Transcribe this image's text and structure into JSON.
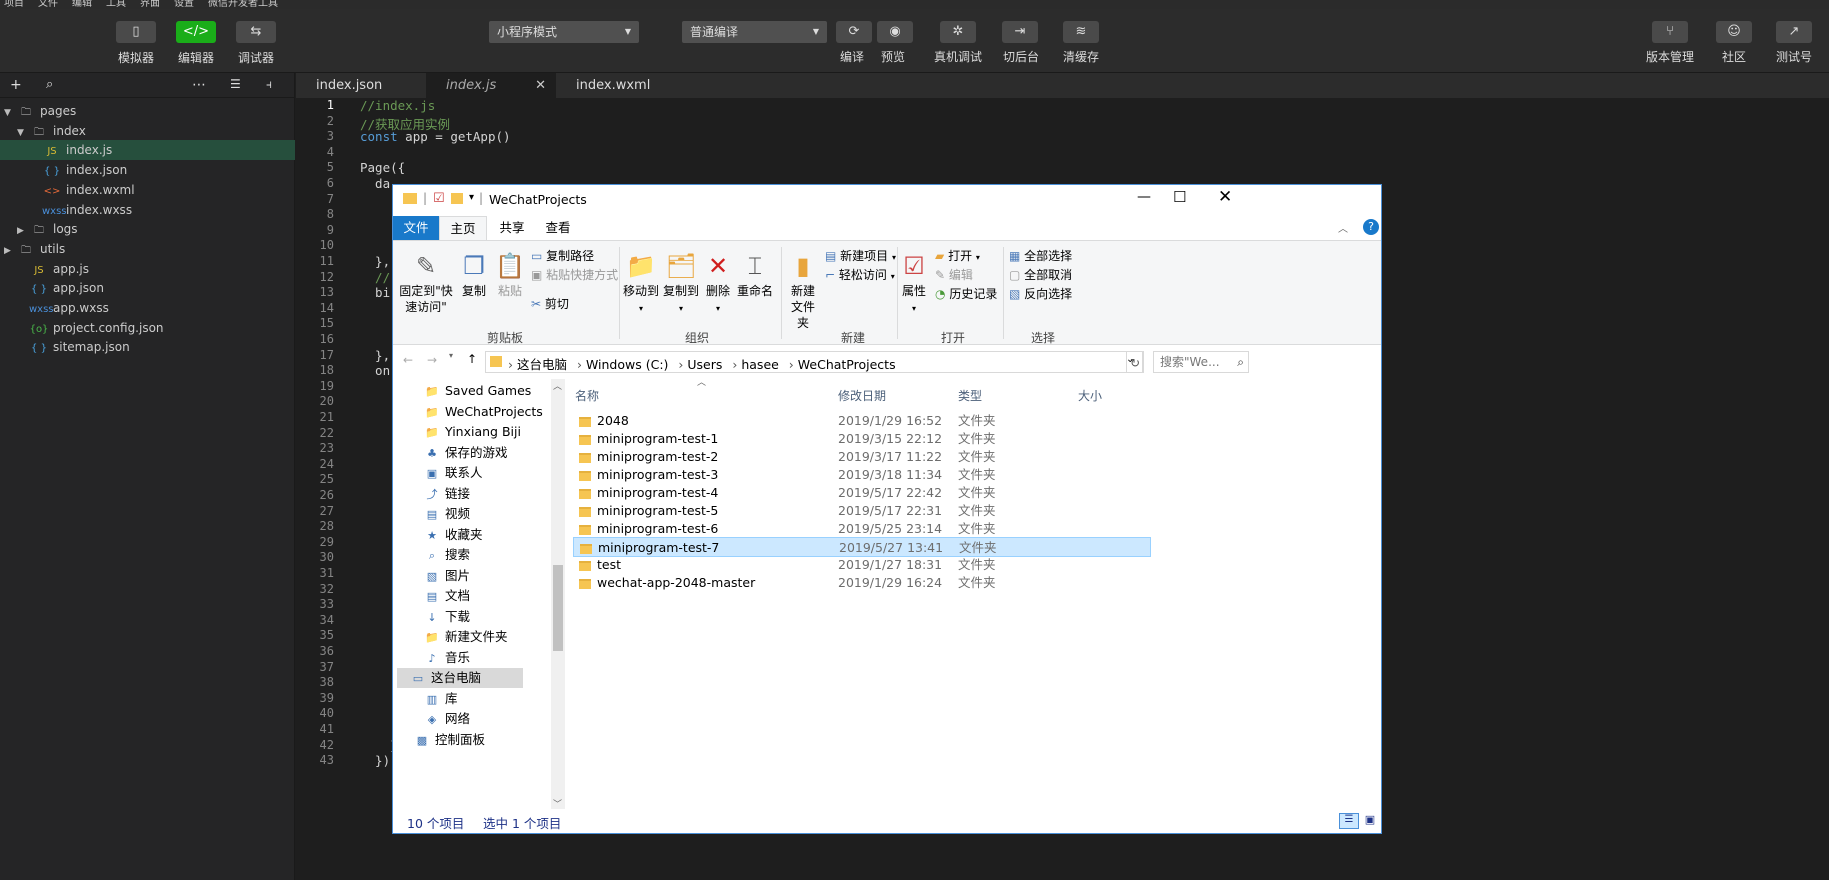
{
  "menu_strip": [
    "项目",
    "文件",
    "编辑",
    "工具",
    "界面",
    "设置",
    "微信开发者工具"
  ],
  "toolbar": {
    "simulator": "模拟器",
    "editor": "编辑器",
    "debugger": "调试器",
    "mode_select": "小程序模式",
    "compile_select": "普通编译",
    "compile": "编译",
    "preview": "预览",
    "remote_debug": "真机调试",
    "background": "切后台",
    "clear_cache": "清缓存",
    "version": "版本管理",
    "community": "社区",
    "test": "测试号"
  },
  "tree": [
    {
      "label": "pages",
      "type": "folder",
      "open": true
    },
    {
      "label": "index",
      "type": "folder",
      "open": true
    },
    {
      "label": "index.js",
      "type": "js",
      "selected": true
    },
    {
      "label": "index.json",
      "type": "json"
    },
    {
      "label": "index.wxml",
      "type": "wxml"
    },
    {
      "label": "index.wxss",
      "type": "wxss"
    },
    {
      "label": "logs",
      "type": "folder",
      "open": false
    },
    {
      "label": "utils",
      "type": "folder",
      "open": false
    },
    {
      "label": "app.js",
      "type": "js"
    },
    {
      "label": "app.json",
      "type": "json"
    },
    {
      "label": "app.wxss",
      "type": "wxss"
    },
    {
      "label": "project.config.json",
      "type": "config"
    },
    {
      "label": "sitemap.json",
      "type": "json"
    }
  ],
  "tabs": [
    "index.json",
    "index.js",
    "index.wxml"
  ],
  "code": {
    "line_numbers": [
      "1",
      "2",
      "3",
      "4",
      "5",
      "6",
      "7",
      "8",
      "9",
      "10",
      "11",
      "12",
      "13",
      "14",
      "15",
      "16",
      "17",
      "18",
      "19",
      "20",
      "21",
      "22",
      "23",
      "24",
      "25",
      "26",
      "27",
      "28",
      "29",
      "30",
      "31",
      "32",
      "33",
      "34",
      "35",
      "36",
      "37",
      "38",
      "39",
      "40",
      "41",
      "42",
      "43"
    ],
    "l1": "//index.js",
    "l2": "//获取应用实例",
    "l3_kw": "const",
    "l3": " app = getApp()",
    "l5": "Page({",
    "l6": "  da",
    "l11": "  },",
    "l12": "  //",
    "l13": "  bi",
    "l17": "  },",
    "l18": "  on",
    "l42": "    }",
    "l43": "  })"
  },
  "explorer": {
    "title": "WeChatProjects",
    "ribbon_tabs": [
      "文件",
      "主页",
      "共享",
      "查看"
    ],
    "pin": "固定到\"快速访问\"",
    "copy": "复制",
    "paste": "粘贴",
    "copy_path": "复制路径",
    "paste_shortcut": "粘贴快捷方式",
    "cut": "剪切",
    "clipboard": "剪贴板",
    "move_to": "移动到",
    "copy_to": "复制到",
    "delete": "删除",
    "rename": "重命名",
    "organize": "组织",
    "new_folder": "新建文件夹",
    "new_item": "新建项目",
    "easy_access": "轻松访问",
    "new_group": "新建",
    "properties": "属性",
    "open": "打开",
    "edit": "编辑",
    "history": "历史记录",
    "open_group": "打开",
    "select_all": "全部选择",
    "select_none": "全部取消",
    "invert": "反向选择",
    "select_group": "选择",
    "breadcrumb": [
      "这台电脑",
      "Windows (C:)",
      "Users",
      "hasee",
      "WeChatProjects"
    ],
    "search_placeholder": "搜索\"We...",
    "nav": [
      "Saved Games",
      "WeChatProjects",
      "Yinxiang Biji",
      "保存的游戏",
      "联系人",
      "链接",
      "视频",
      "收藏夹",
      "搜索",
      "图片",
      "文档",
      "下载",
      "新建文件夹",
      "音乐",
      "这台电脑",
      "库",
      "网络",
      "控制面板"
    ],
    "columns": {
      "name": "名称",
      "date": "修改日期",
      "type": "类型",
      "size": "大小"
    },
    "files": [
      {
        "name": "2048",
        "date": "2019/1/29 16:52",
        "type": "文件夹"
      },
      {
        "name": "miniprogram-test-1",
        "date": "2019/3/15 22:12",
        "type": "文件夹"
      },
      {
        "name": "miniprogram-test-2",
        "date": "2019/3/17 11:22",
        "type": "文件夹"
      },
      {
        "name": "miniprogram-test-3",
        "date": "2019/3/18 11:34",
        "type": "文件夹"
      },
      {
        "name": "miniprogram-test-4",
        "date": "2019/5/17 22:42",
        "type": "文件夹"
      },
      {
        "name": "miniprogram-test-5",
        "date": "2019/5/17 22:31",
        "type": "文件夹"
      },
      {
        "name": "miniprogram-test-6",
        "date": "2019/5/25 23:14",
        "type": "文件夹"
      },
      {
        "name": "miniprogram-test-7",
        "date": "2019/5/27 13:41",
        "type": "文件夹",
        "selected": true
      },
      {
        "name": "test",
        "date": "2019/1/27 18:31",
        "type": "文件夹"
      },
      {
        "name": "wechat-app-2048-master",
        "date": "2019/1/29 16:24",
        "type": "文件夹"
      }
    ],
    "status_count": "10 个项目",
    "status_selected": "选中 1 个项目"
  },
  "colors": {
    "accent_green": "#1aad19",
    "explorer_blue": "#1979ca",
    "selection": "#cce8ff"
  }
}
